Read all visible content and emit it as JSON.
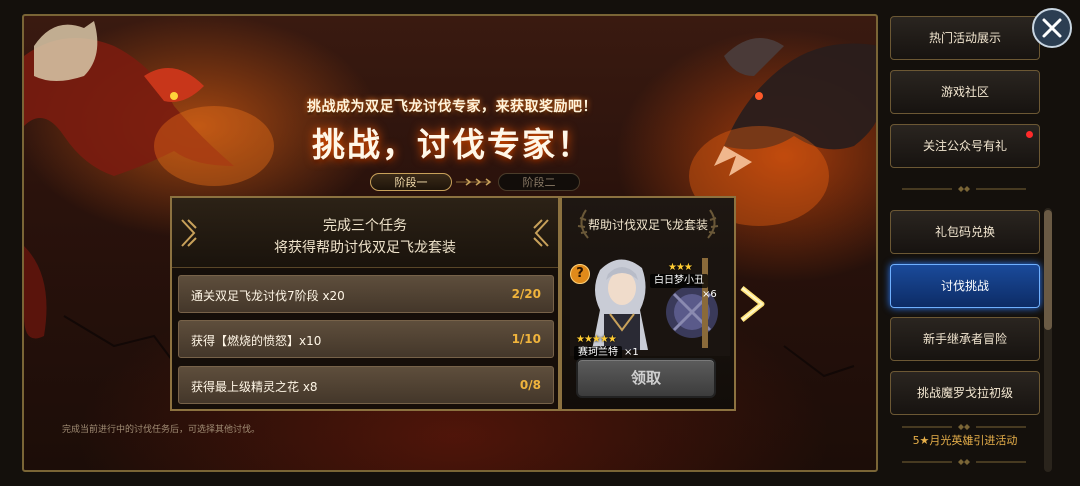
{
  "event": {
    "subtitle": "挑战成为双足飞龙讨伐专家，来获取奖励吧！",
    "title": "挑战，讨伐专家！"
  },
  "stages": [
    {
      "label": "阶段一",
      "state": "active"
    },
    {
      "label": "阶段二",
      "state": "locked"
    }
  ],
  "task_panel": {
    "heading_line1": "完成三个任务",
    "heading_line2": "将获得帮助讨伐双足飞龙套装",
    "tasks": [
      {
        "name": "通关双足飞龙讨伐7阶段 x20",
        "progress": "2/20"
      },
      {
        "name": "获得【燃烧的愤怒】x10",
        "progress": "1/10"
      },
      {
        "name": "获得最上级精灵之花 x8",
        "progress": "0/8"
      }
    ]
  },
  "reward_panel": {
    "title": "帮助讨伐双足飞龙套装",
    "help_icon": "?",
    "items": [
      {
        "name": "白日梦小丑",
        "qty": "×6",
        "stars": "★★★"
      },
      {
        "name": "赛珂兰特",
        "qty": "×1",
        "stars": "★★★★★"
      }
    ],
    "claim_label": "领取"
  },
  "footnote": "完成当前进行中的讨伐任务后，可选择其他讨伐。",
  "sidebar": {
    "items": [
      {
        "label": "热门活动展示"
      },
      {
        "label": "游戏社区"
      },
      {
        "label": "关注公众号有礼",
        "notification": true
      },
      {
        "label": "礼包码兑换"
      },
      {
        "label": "讨伐挑战",
        "active": true
      },
      {
        "label": "新手继承者冒险"
      },
      {
        "label": "挑战魔罗戈拉初级"
      }
    ],
    "promo": "5★月光英雄引进活动"
  },
  "colors": {
    "accent_gold": "#c8a15a",
    "progress_text": "#f0b43c",
    "active_tab": "#1a4a9a",
    "notification": "#ff2a2a"
  },
  "icons": {
    "close": "close-icon",
    "next": "chevron-right-icon",
    "help": "question-icon"
  }
}
